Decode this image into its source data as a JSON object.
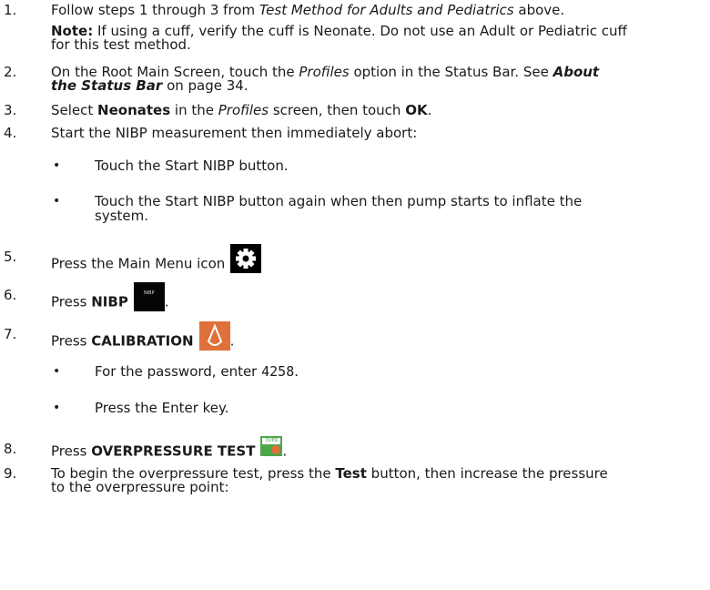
{
  "steps": [
    {
      "num": "1.",
      "pre": "Follow steps 1 through 3 from ",
      "em": "Test Method for Adults and Pediatrics",
      "post": " above."
    },
    {
      "num": "2.",
      "line1_pre": "On the Root Main Screen, touch the ",
      "line1_em": "Profiles",
      "line1_mid": " option in the Status Bar. See ",
      "line1_bold": "About",
      "line2_bold": "the Status Bar",
      "line2_post": " on page 34."
    },
    {
      "num": "3.",
      "pre": "Select ",
      "bold": "Neonates",
      "mid": " in the ",
      "em": "Profiles",
      "mid2": " screen, then touch ",
      "bold2": "OK",
      "post": "."
    },
    {
      "num": "4.",
      "text": "Start the NIBP measurement then immediately abort:"
    },
    {
      "num": "5.",
      "text": "Press the Main Menu icon"
    },
    {
      "num": "6.",
      "pre": "Press ",
      "bold": "NIBP",
      "post": "."
    },
    {
      "num": "7.",
      "pre": "Press ",
      "bold": "CALIBRATION",
      "post": "."
    },
    {
      "num": "8.",
      "pre": "Press ",
      "bold": "OVERPRESSURE TEST",
      "post": "."
    },
    {
      "num": "9.",
      "line1_pre": "To begin the overpressure test, press the ",
      "line1_bold": "Test",
      "line1_post": " button, then increase the pressure",
      "line2": "to the overpressure point:"
    }
  ],
  "note": {
    "label": "Note:",
    "line1": " If using a cuff, verify the cuff is Neonate. Do not use an Adult or Pediatric cuff",
    "line2": "for this test method."
  },
  "step4_bullets": [
    {
      "text": "Touch the Start NIBP button."
    },
    {
      "line1": "Touch the Start NIBP button again when then pump starts to inflate the",
      "line2": "system."
    }
  ],
  "step7_bullets": [
    {
      "pre": "For the password, enter ",
      "code": "4258",
      "post": "."
    },
    {
      "text": "Press the Enter key."
    }
  ],
  "icons": {
    "gear": "gear-icon",
    "nibp": "NIBP",
    "calibration": "calibration-icon",
    "overpressure": "OVER"
  },
  "colors": {
    "text": "#1a1a1a",
    "calibration_icon": "#e0703a",
    "overpressure_icon": "#4ea64a"
  }
}
